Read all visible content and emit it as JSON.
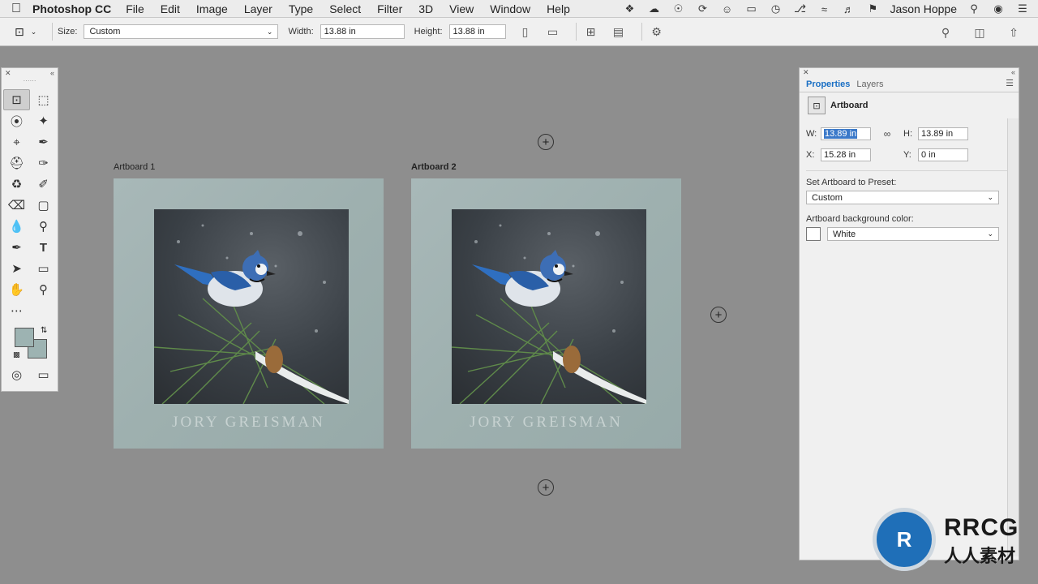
{
  "menubar": {
    "app_name": "Photoshop CC",
    "items": [
      "File",
      "Edit",
      "Image",
      "Layer",
      "Type",
      "Select",
      "Filter",
      "3D",
      "View",
      "Window",
      "Help"
    ],
    "user": "Jason Hoppe"
  },
  "options": {
    "size_label": "Size:",
    "size_value": "Custom",
    "width_label": "Width:",
    "width_value": "13.88 in",
    "height_label": "Height:",
    "height_value": "13.88 in"
  },
  "artboards": [
    {
      "label": "Artboard 1",
      "caption": "JORY GREISMAN"
    },
    {
      "label": "Artboard 2",
      "caption": "JORY GREISMAN"
    }
  ],
  "properties": {
    "tabs": [
      "Properties",
      "Layers"
    ],
    "section_title": "Artboard",
    "w_label": "W:",
    "w_value": "13.89 in",
    "h_label": "H:",
    "h_value": "13.89 in",
    "x_label": "X:",
    "x_value": "15.28 in",
    "y_label": "Y:",
    "y_value": "0 in",
    "preset_heading": "Set Artboard to Preset:",
    "preset_value": "Custom",
    "bg_heading": "Artboard background color:",
    "bg_value": "White"
  },
  "watermark": {
    "logo_text": "RRCG",
    "logo_sub": "人人素材"
  },
  "colors": {
    "canvas": "#8e8e8e",
    "artboard_bg": "#a8b8b8",
    "selection": "#3b79c9",
    "active_tab": "#1a6fc4"
  }
}
